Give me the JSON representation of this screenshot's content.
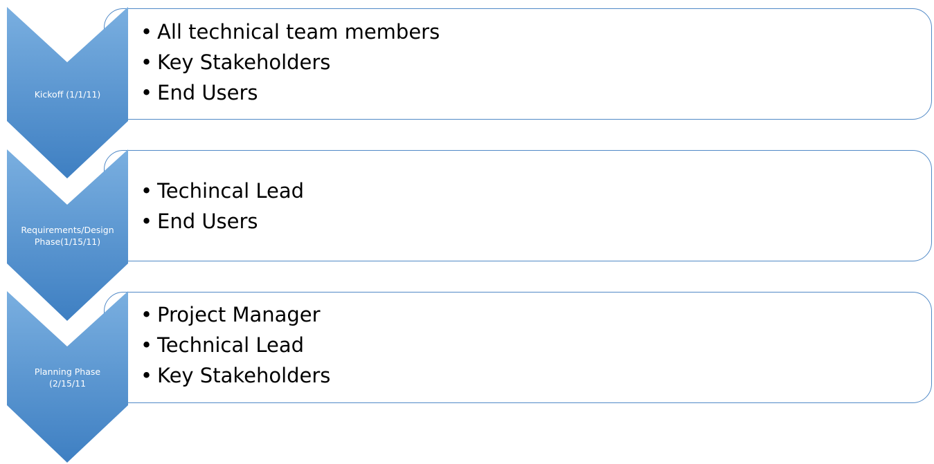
{
  "colors": {
    "chevron_top": "#7aafe0",
    "chevron_bottom": "#3e7fc2",
    "box_border": "#4f88c6"
  },
  "bullet_glyph": "•",
  "stages": [
    {
      "label_lines": [
        "Kickoff (1/1/11)"
      ],
      "items": [
        "All technical team members",
        "Key Stakeholders",
        "End Users"
      ]
    },
    {
      "label_lines": [
        "Requirements/Design",
        "Phase(1/15/11)"
      ],
      "items": [
        "Techincal Lead",
        "End Users"
      ]
    },
    {
      "label_lines": [
        "Planning Phase",
        "(2/15/11"
      ],
      "items": [
        "Project Manager",
        "Technical Lead",
        "Key Stakeholders"
      ]
    }
  ]
}
